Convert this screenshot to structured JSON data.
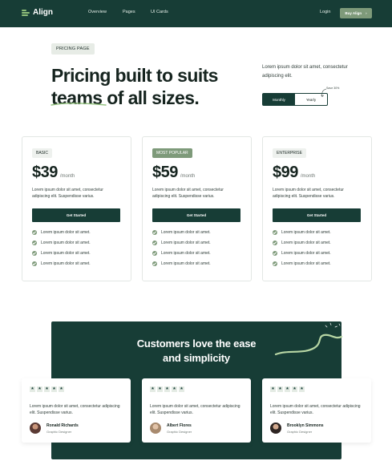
{
  "nav": {
    "logo": "Align",
    "links": [
      "Overview",
      "Pages",
      "UI Cards"
    ],
    "login": "Login",
    "cta": "Buy Align",
    "cta_arrow": "›"
  },
  "hero": {
    "badge": "PRICING PAGE",
    "title_line1": "Pricing built to suits",
    "title_line2": "teams of all sizes.",
    "description": "Lorem ipsum dolor sit amet, consectetur adipiscing elit.",
    "toggle": {
      "monthly": "Monthly",
      "yearly": "Yearly",
      "selected": "Monthly"
    },
    "save_note": "Save 30%"
  },
  "plans": [
    {
      "tier": "BASIC",
      "price": "$39",
      "period": "/month",
      "description": "Lorem ipsum dolor sit amet, consectetur adipiscing elit. Suspendisse varius.",
      "button": "Get Started",
      "features": [
        "Lorem ipsum dolor sit amet.",
        "Lorem ipsum dolor sit amet.",
        "Lorem ipsum dolor sit amet.",
        "Lorem ipsum dolor sit amet."
      ]
    },
    {
      "tier": "MOST POPULAR",
      "price": "$59",
      "period": "/month",
      "description": "Lorem ipsum dolor sit amet, consectetur adipiscing elit. Suspendisse varius.",
      "button": "Get Started",
      "features": [
        "Lorem ipsum dolor sit amet.",
        "Lorem ipsum dolor sit amet.",
        "Lorem ipsum dolor sit amet.",
        "Lorem ipsum dolor sit amet."
      ]
    },
    {
      "tier": "ENTERPRISE",
      "price": "$99",
      "period": "/month",
      "description": "Lorem ipsum dolor sit amet, consectetur adipiscing elit. Suspendisse varius.",
      "button": "Get Started",
      "features": [
        "Lorem ipsum dolor sit amet.",
        "Lorem ipsum dolor sit amet.",
        "Lorem ipsum dolor sit amet.",
        "Lorem ipsum dolor sit amet."
      ]
    }
  ],
  "testimonials": {
    "title_line1": "Customers love the ease",
    "title_line2": "and simplicity",
    "items": [
      {
        "rating": 5,
        "star": "★",
        "text": "Lorem ipsum dolor sit amet, consectetur adipiscing elit. Suspendisse varius.",
        "name": "Ronald Richards",
        "role": "Graphic Designer"
      },
      {
        "rating": 5,
        "star": "★",
        "text": "Lorem ipsum dolor sit amet, consectetur adipiscing elit. Suspendisse varius.",
        "name": "Albert Flores",
        "role": "Graphic Designer"
      },
      {
        "rating": 5,
        "star": "★",
        "text": "Lorem ipsum dolor sit amet, consectetur adipiscing elit. Suspendisse varius.",
        "name": "Brooklyn Simmons",
        "role": "Graphic Designer"
      }
    ]
  },
  "colors": {
    "brand_dark": "#173d36",
    "accent_sage": "#7e9a7a",
    "accent_light": "#8fbf7a",
    "badge_bg": "#e7ece6"
  },
  "icons": [
    "logo-bars-icon",
    "arrow-right-icon",
    "curved-arrow-icon",
    "check-circle-icon",
    "star-icon",
    "swirl-decoration"
  ]
}
